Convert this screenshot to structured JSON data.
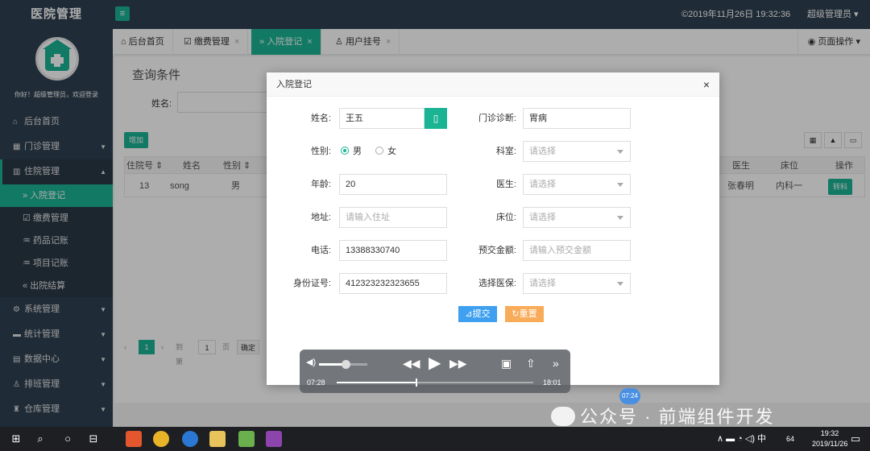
{
  "app": {
    "title": "医院管理",
    "menu_toggle_icon": "≡",
    "datetime": "©2019年11月26日 19:32:36",
    "user": "超级管理员 ▾"
  },
  "sidebar": {
    "welcome": "你好！超级管理员，欢迎登录",
    "items": [
      {
        "label": "后台首页",
        "icon": "home-icon",
        "glyph": "⌂"
      },
      {
        "label": "门诊管理",
        "icon": "grid-icon",
        "glyph": "▦",
        "caret": "▼"
      },
      {
        "label": "住院管理",
        "icon": "bed-icon",
        "glyph": "▥",
        "caret": "▲"
      },
      {
        "label": "系统管理",
        "icon": "gear-icon",
        "glyph": "⚙",
        "caret": "▼"
      },
      {
        "label": "统计管理",
        "icon": "chart-icon",
        "glyph": "▬",
        "caret": "▼"
      },
      {
        "label": "数据中心",
        "icon": "data-icon",
        "glyph": "▤",
        "caret": "▼"
      },
      {
        "label": "排班管理",
        "icon": "user-icon",
        "glyph": "♙",
        "caret": "▼"
      },
      {
        "label": "仓库管理",
        "icon": "warehouse-icon",
        "glyph": "♜",
        "caret": "▼"
      }
    ],
    "sub_items": [
      {
        "label": "入院登记",
        "glyph": "»"
      },
      {
        "label": "缴费管理",
        "glyph": "☑"
      },
      {
        "label": "药品记账",
        "glyph": "♒"
      },
      {
        "label": "项目记账",
        "glyph": "♒"
      },
      {
        "label": "出院结算",
        "glyph": "«"
      }
    ]
  },
  "tabs": [
    {
      "label": "后台首页",
      "glyph": "⌂",
      "close": ""
    },
    {
      "label": "缴费管理",
      "glyph": "☑",
      "close": "×"
    },
    {
      "label": "入院登记",
      "glyph": "»",
      "close": "×"
    },
    {
      "label": "用户挂号",
      "glyph": "♙",
      "close": "×"
    }
  ],
  "page_ops": "◉ 页面操作 ▾",
  "query": {
    "title": "查询条件",
    "name_label": "姓名:",
    "add_button": "增加"
  },
  "toolbar": {
    "tool1": "▦",
    "tool2": "▲",
    "tool3": "▭"
  },
  "table": {
    "headers": [
      "住院号 ⇕",
      "姓名",
      "性别 ⇕",
      "医生",
      "床位",
      "操作"
    ],
    "row": {
      "id": "13",
      "name": "song",
      "gender": "男",
      "doctor": "张春明",
      "bed": "内科一",
      "action": "转科"
    }
  },
  "pager": {
    "prev": "‹",
    "current": "1",
    "next": "›",
    "goto": "到第",
    "page_value": "1",
    "page_unit": "页",
    "confirm": "确定"
  },
  "modal": {
    "title": "入院登记",
    "close": "×",
    "labels": {
      "name": "姓名:",
      "gender": "性别:",
      "age": "年龄:",
      "address": "地址:",
      "phone": "电话:",
      "idcard": "身份证号:",
      "diagnosis": "门诊诊断:",
      "dept": "科室:",
      "doctor": "医生:",
      "bed": "床位:",
      "deposit": "预交金额:",
      "insurance": "选择医保:"
    },
    "values": {
      "name": "王五",
      "age": "20",
      "phone": "13388330740",
      "idcard": "412323232323655",
      "diagnosis": "胃病"
    },
    "placeholders": {
      "address": "请输入住址",
      "dept": "请选择",
      "doctor": "请选择",
      "bed": "请选择",
      "deposit": "请输入预交金额",
      "insurance": "请选择"
    },
    "gender_options": {
      "male": "男",
      "female": "女"
    },
    "gender_selected": "male",
    "name_button_icon": "▯",
    "submit": "⊿提交",
    "reset": "↻重置"
  },
  "player": {
    "volume": 0.55,
    "progress": 0.4,
    "current_time": "07:28",
    "total_time": "18:01",
    "bubble_time": "07:24",
    "icons": {
      "volume": "◀)",
      "rewind": "◀◀",
      "play": "▶",
      "forward": "▶▶",
      "pip": "▣",
      "share": "⇧",
      "more": "»"
    }
  },
  "watermark": "公众号 · 前端组件开发",
  "taskbar": {
    "clock_time": "19:32",
    "clock_date": "2019/11/26",
    "tray": "∧ ▬ ◔ ◁) 中",
    "tray_badge": "64",
    "icons": {
      "start": "⊞",
      "search": "⌕",
      "task": "○",
      "taskview": "⊟",
      "notify": "▭"
    }
  }
}
